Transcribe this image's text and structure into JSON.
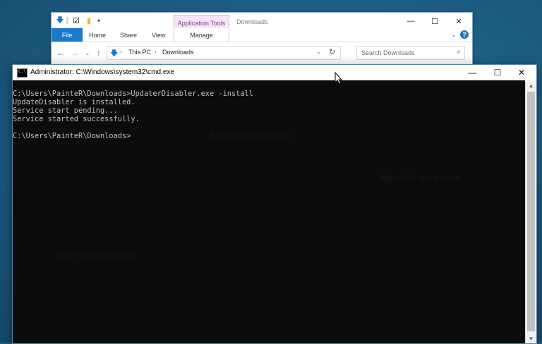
{
  "explorer": {
    "contextual_tab": "Application Tools",
    "title": "Downloads",
    "tabs": [
      "File",
      "Home",
      "Share",
      "View"
    ],
    "manage_tab": "Manage",
    "breadcrumb": [
      "This PC",
      "Downloads"
    ],
    "search_placeholder": "Search Downloads"
  },
  "cmd": {
    "title": "Administrator: C:\\Windows\\system32\\cmd.exe",
    "icon_text": "C:\\",
    "lines": [
      "C:\\Users\\PainteR\\Downloads>UpdaterDisabler.exe -install",
      "UpdateDisabler is installed.",
      "Service start pending...",
      "Service started successfully.",
      "",
      "C:\\Users\\PainteR\\Downloads>"
    ]
  },
  "watermark": "http://winaero.com",
  "colors": {
    "accent": "#1979ca",
    "console_bg": "#0c0c0c",
    "console_text": "#c0c0c0",
    "app_tools": "#f7e6f7"
  }
}
